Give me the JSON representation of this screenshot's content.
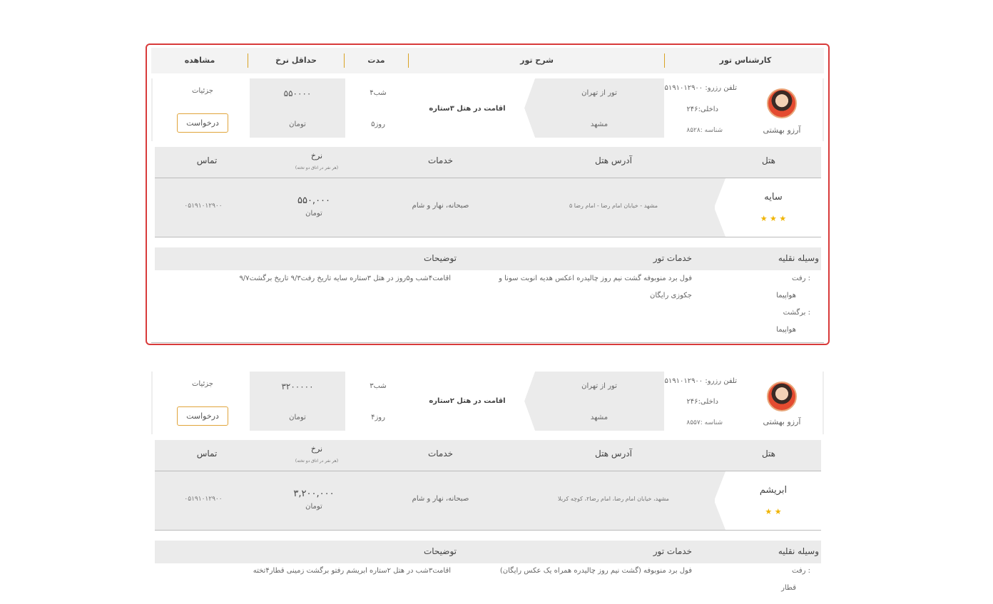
{
  "headers": {
    "expert": "کارشناس تور",
    "description": "شرح تور",
    "duration": "مدت",
    "min_rate": "حداقل نرخ",
    "view": "مشاهده"
  },
  "tours": [
    {
      "expert_name": "آرزو بهشتی",
      "phone": "تلفن رزرو: ۰۵۱۹۱۰۱۲۹۰۰",
      "internal": "داخلی:۲۴۶",
      "id_label": "شناسه :۸۵۲۸",
      "tour_from": "تور از تهران",
      "destination": "مشهد",
      "stay": "اقامت در هتل ۳ستاره",
      "nights": "۴شب",
      "days": "۵روز",
      "price": "۵۵۰۰۰۰",
      "currency": "تومان",
      "details": "جزئیات",
      "request": "درخواست",
      "hotel_headers": {
        "hotel": "هتل",
        "address": "آدرس هتل",
        "services": "خدمات",
        "rate": "نرخ",
        "rate_note": "(هر نفر در اتاق دو تخته)",
        "contact": "تماس"
      },
      "hotel_name": "سایه",
      "hotel_stars": "★ ★ ★",
      "hotel_address": "مشهد - خیابان امام رضا - امام رضا ۵",
      "hotel_services": "صبحانه، نهار و شام",
      "hotel_price": "۵۵۰,۰۰۰",
      "hotel_currency": "تومان",
      "hotel_contact": "۰۵۱۹۱۰۱۲۹۰۰",
      "transport_headers": {
        "vehicle": "وسیله نقلیه",
        "tour_services": "خدمات تور",
        "notes": "توضیحات"
      },
      "go_label": "رفت :",
      "go_vehicle": "هواپیما",
      "return_label": "برگشت :",
      "return_vehicle": "هواپیما",
      "services_line1": "فول برد منوبوفه گشت نیم روز چالیدره اعکس هدیه انوبت سونا و",
      "services_line2": "جکوزی رایگان",
      "notes_text": "اقامت۴شب و۵روز در هتل ۳ستاره سایه تاریخ رفت۹/۳ تاریخ برگشت۹/۷"
    },
    {
      "expert_name": "آرزو بهشتی",
      "phone": "تلفن رزرو: ۰۵۱۹۱۰۱۲۹۰۰",
      "internal": "داخلی:۲۴۶",
      "id_label": "شناسه :۸۵۵۷",
      "tour_from": "تور از تهران",
      "destination": "مشهد",
      "stay": "اقامت در هتل ۲ستاره",
      "nights": "۳شب",
      "days": "۴روز",
      "price": "۳۲۰۰۰۰۰",
      "currency": "تومان",
      "details": "جزئیات",
      "request": "درخواست",
      "hotel_headers": {
        "hotel": "هتل",
        "address": "آدرس هتل",
        "services": "خدمات",
        "rate": "نرخ",
        "rate_note": "(هر نفر در اتاق دو تخته)",
        "contact": "تماس"
      },
      "hotel_name": "ابریشم",
      "hotel_stars": "★ ★",
      "hotel_address": "مشهد، خیابان امام رضا، امام رضا۲، کوچه کربلا",
      "hotel_services": "صبحانه، نهار و شام",
      "hotel_price": "۳,۲۰۰,۰۰۰",
      "hotel_currency": "تومان",
      "hotel_contact": "۰۵۱۹۱۰۱۲۹۰۰",
      "transport_headers": {
        "vehicle": "وسیله نقلیه",
        "tour_services": "خدمات تور",
        "notes": "توضیحات"
      },
      "go_label": "رفت :",
      "go_vehicle": "قطار",
      "services_line1": "فول برد منوبوفه (گشت نیم روز چالیدره همراه یک عکس رایگان)",
      "notes_text": "اقامت۳شب در هتل ۲ستاره ابریشم رفتو برگشت زمینی قطار۴تخته"
    }
  ]
}
